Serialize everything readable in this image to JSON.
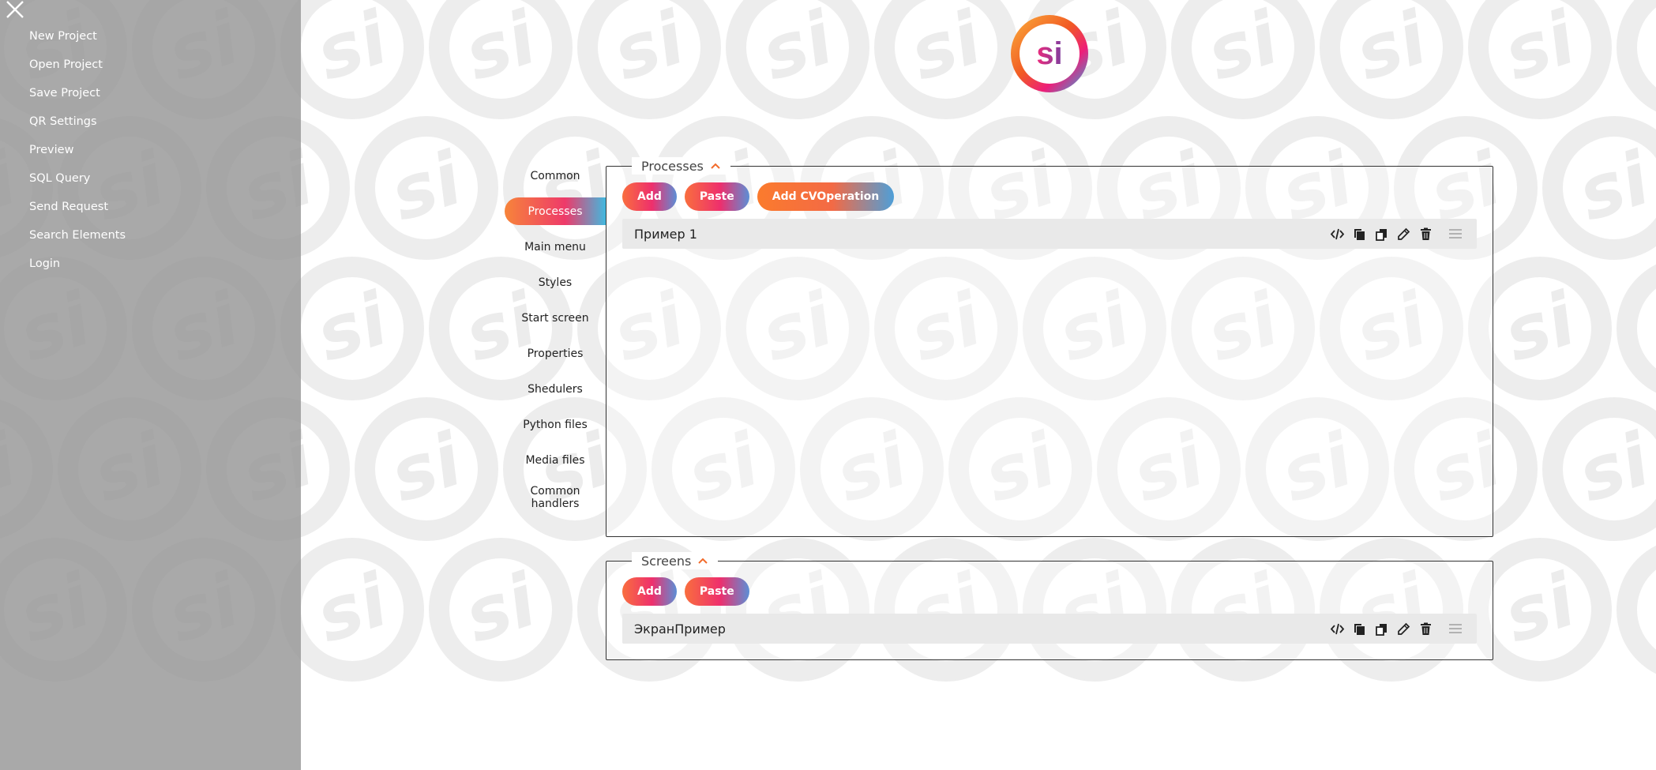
{
  "side_menu": {
    "items": [
      "New Project",
      "Open Project",
      "Save Project",
      "QR Settings",
      "Preview",
      "SQL Query",
      "Send Request",
      "Search Elements",
      "Login"
    ]
  },
  "logo": {
    "text": "si"
  },
  "tabs": [
    {
      "label": "Common",
      "active": false
    },
    {
      "label": "Processes",
      "active": true
    },
    {
      "label": "Main menu",
      "active": false
    },
    {
      "label": "Styles",
      "active": false
    },
    {
      "label": "Start screen",
      "active": false
    },
    {
      "label": "Properties",
      "active": false
    },
    {
      "label": "Shedulers",
      "active": false
    },
    {
      "label": "Python files",
      "active": false
    },
    {
      "label": "Media files",
      "active": false
    },
    {
      "label": "Common handlers",
      "active": false
    }
  ],
  "processes": {
    "title": "Processes",
    "buttons": {
      "add": "Add",
      "paste": "Paste",
      "add_cv": "Add CVOperation"
    },
    "items": [
      "Пример 1"
    ]
  },
  "screens": {
    "title": "Screens",
    "buttons": {
      "add": "Add",
      "paste": "Paste"
    },
    "items": [
      "ЭкранПример"
    ]
  },
  "row_actions": [
    "code-icon",
    "copy-icon",
    "duplicate-icon",
    "edit-icon",
    "delete-icon",
    "drag-handle-icon"
  ],
  "colors": {
    "accent_orange": "#f7843a",
    "accent_pink": "#ee3a6a",
    "accent_blue": "#41b9df",
    "menu_bg": "#969696"
  }
}
